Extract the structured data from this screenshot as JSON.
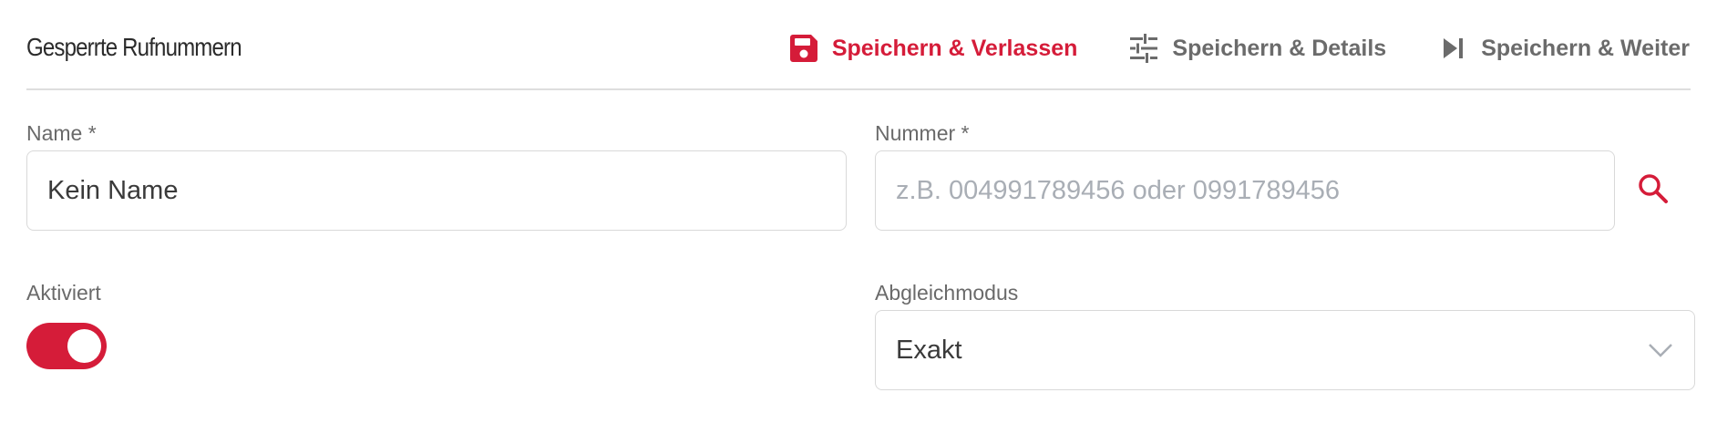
{
  "header": {
    "title": "Gesperrte Rufnummern",
    "actions": [
      {
        "label": "Speichern & Verlassen",
        "icon": "floppy-disk-icon",
        "color": "#d51c39"
      },
      {
        "label": "Speichern & Details",
        "icon": "sliders-icon",
        "color": "#6b6b6b"
      },
      {
        "label": "Speichern & Weiter",
        "icon": "skip-next-icon",
        "color": "#6b6b6b"
      }
    ]
  },
  "form": {
    "name": {
      "label": "Name *",
      "value": "Kein Name"
    },
    "nummer": {
      "label": "Nummer *",
      "value": "",
      "placeholder": "z.B. 004991789456 oder 0991789456",
      "search_icon": "search-icon"
    },
    "aktiviert": {
      "label": "Aktiviert",
      "enabled": true
    },
    "abgleichmodus": {
      "label": "Abgleichmodus",
      "value": "Exakt",
      "icon": "chevron-down-icon"
    }
  },
  "colors": {
    "accent": "#d51c39",
    "secondary_text": "#6b6b6b",
    "border": "#d9d9d9"
  }
}
